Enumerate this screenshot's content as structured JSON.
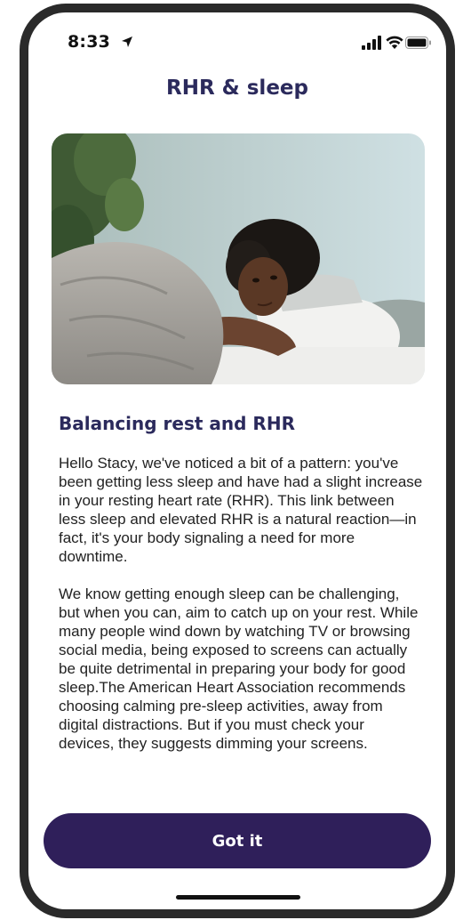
{
  "status_bar": {
    "time": "8:33",
    "icons": [
      "location-arrow-icon",
      "cellular-signal-icon",
      "wifi-icon",
      "battery-icon"
    ]
  },
  "screen": {
    "title": "RHR & sleep"
  },
  "hero_image": {
    "description_icon": "photo-woman-resting-in-bed"
  },
  "article": {
    "heading": "Balancing rest and RHR",
    "paragraphs": [
      "Hello Stacy, we've noticed a bit of a pattern: you've been getting less sleep and have had a slight increase in your resting heart rate (RHR). This link between less sleep and elevated RHR is a natural reaction—in fact, it's your body signaling a need for more downtime.",
      "We know getting enough sleep can be challenging, but when you can, aim to catch up on your rest. While many people wind down by watching TV or browsing social media, being exposed to screens can actually be quite detrimental in preparing your body for good sleep.The American Heart Association recommends choosing calming pre-sleep activities, away from digital distractions. But if you must check your devices, they suggests dimming your screens."
    ]
  },
  "actions": {
    "primary_label": "Got it"
  },
  "colors": {
    "title": "#2b2a5c",
    "button": "#2f1f5a",
    "button_text": "#ffffff"
  }
}
